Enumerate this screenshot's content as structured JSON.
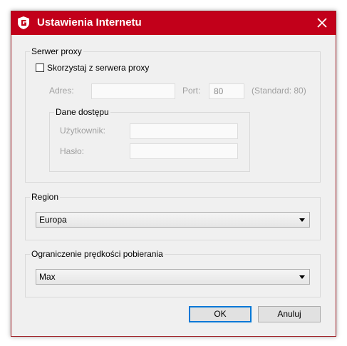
{
  "window": {
    "title": "Ustawienia Internetu"
  },
  "proxy": {
    "group_label": "Serwer proxy",
    "use_proxy_label": "Skorzystaj z serwera proxy",
    "use_proxy_checked": false,
    "address_label": "Adres:",
    "address_value": "",
    "port_label": "Port:",
    "port_value": "80",
    "port_hint": "(Standard: 80)",
    "credentials": {
      "group_label": "Dane dostępu",
      "user_label": "Użytkownik:",
      "user_value": "",
      "password_label": "Hasło:",
      "password_value": ""
    }
  },
  "region": {
    "group_label": "Region",
    "selected": "Europa"
  },
  "speed": {
    "group_label": "Ograniczenie prędkości pobierania",
    "selected": "Max"
  },
  "buttons": {
    "ok": "OK",
    "cancel": "Anuluj"
  },
  "colors": {
    "titlebar": "#c2001a",
    "accent": "#0078d7"
  }
}
